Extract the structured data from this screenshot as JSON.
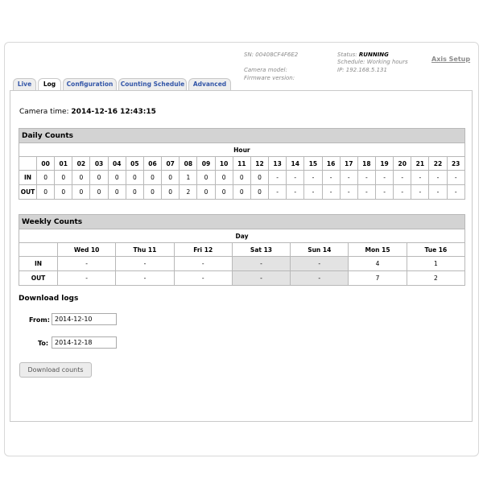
{
  "header": {
    "sn": "SN: 00408CF4F6E2",
    "camera_model_label": "Camera model:",
    "firmware_label": "Firmware version:",
    "status_label": "Status:",
    "status_value": "RUNNING",
    "schedule_label": "Schedule:",
    "schedule_value": "Working hours",
    "ip": "IP: 192.168.5.131",
    "axis_setup": "Axis Setup"
  },
  "tabs": [
    {
      "label": "Live"
    },
    {
      "label": "Log"
    },
    {
      "label": "Configuration"
    },
    {
      "label": "Counting Schedule"
    },
    {
      "label": "Advanced"
    }
  ],
  "active_tab": "Log",
  "camera_time": {
    "label": "Camera time:",
    "value": "2014-12-16 12:43:15"
  },
  "daily": {
    "title": "Daily Counts",
    "axis_label": "Hour",
    "hours": [
      "00",
      "01",
      "02",
      "03",
      "04",
      "05",
      "06",
      "07",
      "08",
      "09",
      "10",
      "11",
      "12",
      "13",
      "14",
      "15",
      "16",
      "17",
      "18",
      "19",
      "20",
      "21",
      "22",
      "23"
    ],
    "rows": [
      {
        "label": "IN",
        "values": [
          "0",
          "0",
          "0",
          "0",
          "0",
          "0",
          "0",
          "0",
          "1",
          "0",
          "0",
          "0",
          "0",
          "-",
          "-",
          "-",
          "-",
          "-",
          "-",
          "-",
          "-",
          "-",
          "-",
          "-"
        ]
      },
      {
        "label": "OUT",
        "values": [
          "0",
          "0",
          "0",
          "0",
          "0",
          "0",
          "0",
          "0",
          "2",
          "0",
          "0",
          "0",
          "0",
          "-",
          "-",
          "-",
          "-",
          "-",
          "-",
          "-",
          "-",
          "-",
          "-",
          "-"
        ]
      }
    ]
  },
  "weekly": {
    "title": "Weekly Counts",
    "axis_label": "Day",
    "days": [
      {
        "label": "Wed 10",
        "shaded": false
      },
      {
        "label": "Thu 11",
        "shaded": false
      },
      {
        "label": "Fri 12",
        "shaded": false
      },
      {
        "label": "Sat 13",
        "shaded": true
      },
      {
        "label": "Sun 14",
        "shaded": true
      },
      {
        "label": "Mon 15",
        "shaded": false
      },
      {
        "label": "Tue 16",
        "shaded": false
      }
    ],
    "rows": [
      {
        "label": "IN",
        "values": [
          "-",
          "-",
          "-",
          "-",
          "-",
          "4",
          "1"
        ]
      },
      {
        "label": "OUT",
        "values": [
          "-",
          "-",
          "-",
          "-",
          "-",
          "7",
          "2"
        ]
      }
    ]
  },
  "download": {
    "title": "Download logs",
    "from_label": "From:",
    "from_value": "2014-12-10",
    "to_label": "To:",
    "to_value": "2014-12-18",
    "button_label": "Download counts"
  },
  "colors": {
    "tab_text": "#3356a8",
    "title_bar": "#d3d3d3",
    "weekend_shade": "#e3e3e3"
  }
}
